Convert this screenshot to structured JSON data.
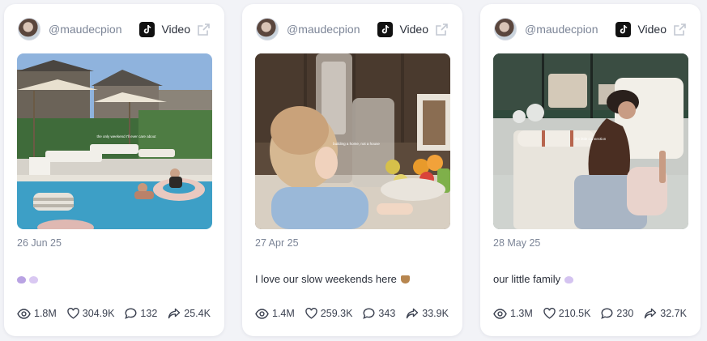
{
  "cards": [
    {
      "handle": "@maudecpion",
      "platform_icon": "tiktok-icon",
      "type_label": "Video",
      "date": "26 Jun 25",
      "caption": "",
      "caption_emojis": [
        "#b9a3e3",
        "#d9c8f2"
      ],
      "thumb_text": "the only weekend I'll ever care about",
      "stats": {
        "views": "1.8M",
        "likes": "304.9K",
        "comments": "132",
        "shares": "25.4K"
      }
    },
    {
      "handle": "@maudecpion",
      "platform_icon": "tiktok-icon",
      "type_label": "Video",
      "date": "27 Apr 25",
      "caption": "I love our slow weekends here",
      "caption_emojis": [
        "#b7864f"
      ],
      "thumb_text": "building a home, not a house",
      "stats": {
        "views": "1.4M",
        "likes": "259.3K",
        "comments": "343",
        "shares": "33.9K"
      }
    },
    {
      "handle": "@maudecpion",
      "platform_icon": "tiktok-icon",
      "type_label": "Video",
      "date": "28 May 25",
      "caption": "our little family",
      "caption_emojis": [
        "#d4c3f0"
      ],
      "thumb_text": "the little connection",
      "stats": {
        "views": "1.3M",
        "likes": "210.5K",
        "comments": "230",
        "shares": "32.7K"
      }
    }
  ]
}
